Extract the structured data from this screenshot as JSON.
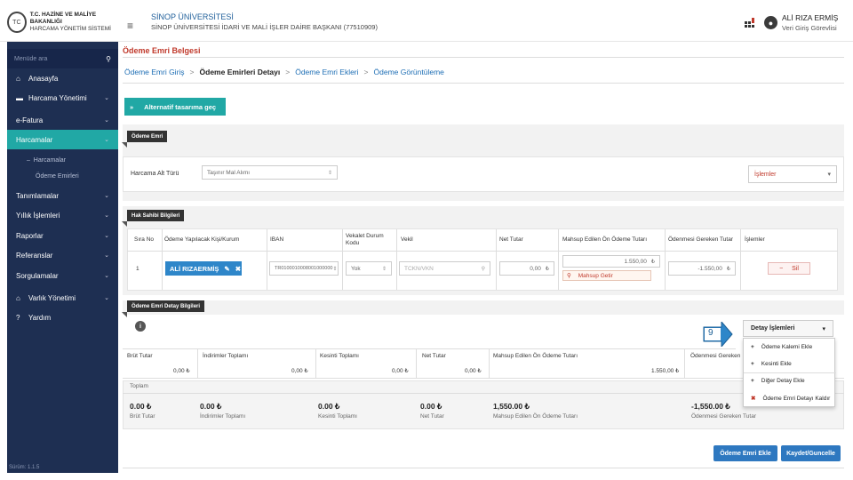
{
  "header": {
    "seal_text": "TC",
    "logo_line1": "T.C. HAZİNE VE MALİYE BAKANLIĞI",
    "logo_line2": "HARCAMA YÖNETİM SİSTEMİ",
    "menu_glyph": "≡",
    "uni_name": "SİNOP ÜNİVERSİTESİ",
    "uni_sub": "SİNOP ÜNİVERSİTESİ İDARİ VE MALİ İŞLER DAİRE BAŞKANI (77510909)",
    "user_name": "ALİ RIZA ERMİŞ",
    "user_role": "Veri Giriş Görevlisi"
  },
  "sidebar": {
    "search_placeholder": "Menüde ara",
    "items": [
      {
        "label": "Anasayfa",
        "icon": "home-icon",
        "glyph": "⌂"
      },
      {
        "label": "Harcama Yönetimi",
        "icon": "card-icon",
        "glyph": "▬"
      },
      {
        "label": "e-Fatura"
      },
      {
        "label": "Harcamalar"
      },
      {
        "label": "Tanımlamalar"
      },
      {
        "label": "Yıllık İşlemleri"
      },
      {
        "label": "Raporlar"
      },
      {
        "label": "Referanslar"
      },
      {
        "label": "Sorgulamalar"
      },
      {
        "label": "Varlık Yönetimi",
        "icon": "bank-icon",
        "glyph": "⌂"
      },
      {
        "label": "Yardım",
        "icon": "help-icon",
        "glyph": "?"
      }
    ],
    "sub_items": [
      "Harcamalar",
      "Ödeme Emirleri"
    ],
    "version": "Sürüm: 1.1.5",
    "active_color": "#21a8a5",
    "bg_color": "#1e2f52"
  },
  "page": {
    "title": "Ödeme Emri Belgesi",
    "breadcrumbs": [
      "Ödeme Emri Giriş",
      "Ödeme Emirleri Detayı",
      "Ödeme Emri Ekleri",
      "Ödeme Görüntüleme"
    ],
    "breadcrumb_sep": ">",
    "alt_button": "Alternatif tasarıma geç",
    "alt_button_icon": "»"
  },
  "odeme_emri": {
    "tag": "Ödeme Emri",
    "harcama_label": "Harcama Alt Türü",
    "harcama_value": "Taşınır Mal Alımı",
    "islemler": "İşlemler"
  },
  "hak_sahibi": {
    "tag": "Hak Sahibi Bilgileri",
    "columns": [
      "Sıra No",
      "Ödeme Yapılacak Kişi/Kurum",
      "IBAN",
      "Vekalet Durum Kodu",
      "Vekil",
      "Net Tutar",
      "Mahsup Edilen Ön Ödeme Tutarı",
      "Ödenmesi Gereken Tutar",
      "İşlemler"
    ],
    "row": {
      "sira": "1",
      "person": "ALİ RIZAERMİŞ",
      "iban": "TR0100010008001000000",
      "vekalet": "Yok",
      "vekil_placeholder": "TCKN/VKN",
      "net": "0,00",
      "mahsup": "1.550,00",
      "mahsup_btn": "Mahsup Getir",
      "odenmesi": "-1.550,00",
      "sil": "Sil",
      "currency": "₺"
    }
  },
  "detay": {
    "tag": "Ödeme Emri Detay Bilgileri",
    "info": "i",
    "callout_number": "9",
    "button": "Detay İşlemleri",
    "menu": [
      {
        "label": "Ödeme Kalemi Ekle",
        "mark": "+"
      },
      {
        "label": "Kesinti Ekle",
        "mark": "+"
      },
      {
        "label": "Diğer Detay Ekle",
        "mark": "+"
      },
      {
        "label": "Ödeme Emri Detayı Kaldır",
        "mark": "✖"
      }
    ],
    "columns": [
      "Brüt Tutar",
      "İndirimler Toplamı",
      "Kesinti Toplamı",
      "Net Tutar",
      "Mahsup Edilen Ön Ödeme Tutarı",
      "Ödenmesi Gereken"
    ],
    "row_values": [
      "0,00 ₺",
      "0,00 ₺",
      "0,00 ₺",
      "0,00 ₺",
      "1.550,00 ₺"
    ],
    "toplam_label": "Toplam",
    "totals": [
      {
        "value": "0.00 ₺",
        "label": "Brüt Tutar"
      },
      {
        "value": "0.00 ₺",
        "label": "İndirimler Toplamı"
      },
      {
        "value": "0.00 ₺",
        "label": "Kesinti Toplamı"
      },
      {
        "value": "0.00 ₺",
        "label": "Net Tutar"
      },
      {
        "value": "1,550.00 ₺",
        "label": "Mahsup Edilen Ön Ödeme Tutarı"
      },
      {
        "value": "-1,550.00 ₺",
        "label": "Ödenmesi Gereken Tutar"
      }
    ]
  },
  "footer": {
    "ekle": "Ödeme Emri Ekle",
    "kaydet": "Kaydet/Guncelle"
  }
}
